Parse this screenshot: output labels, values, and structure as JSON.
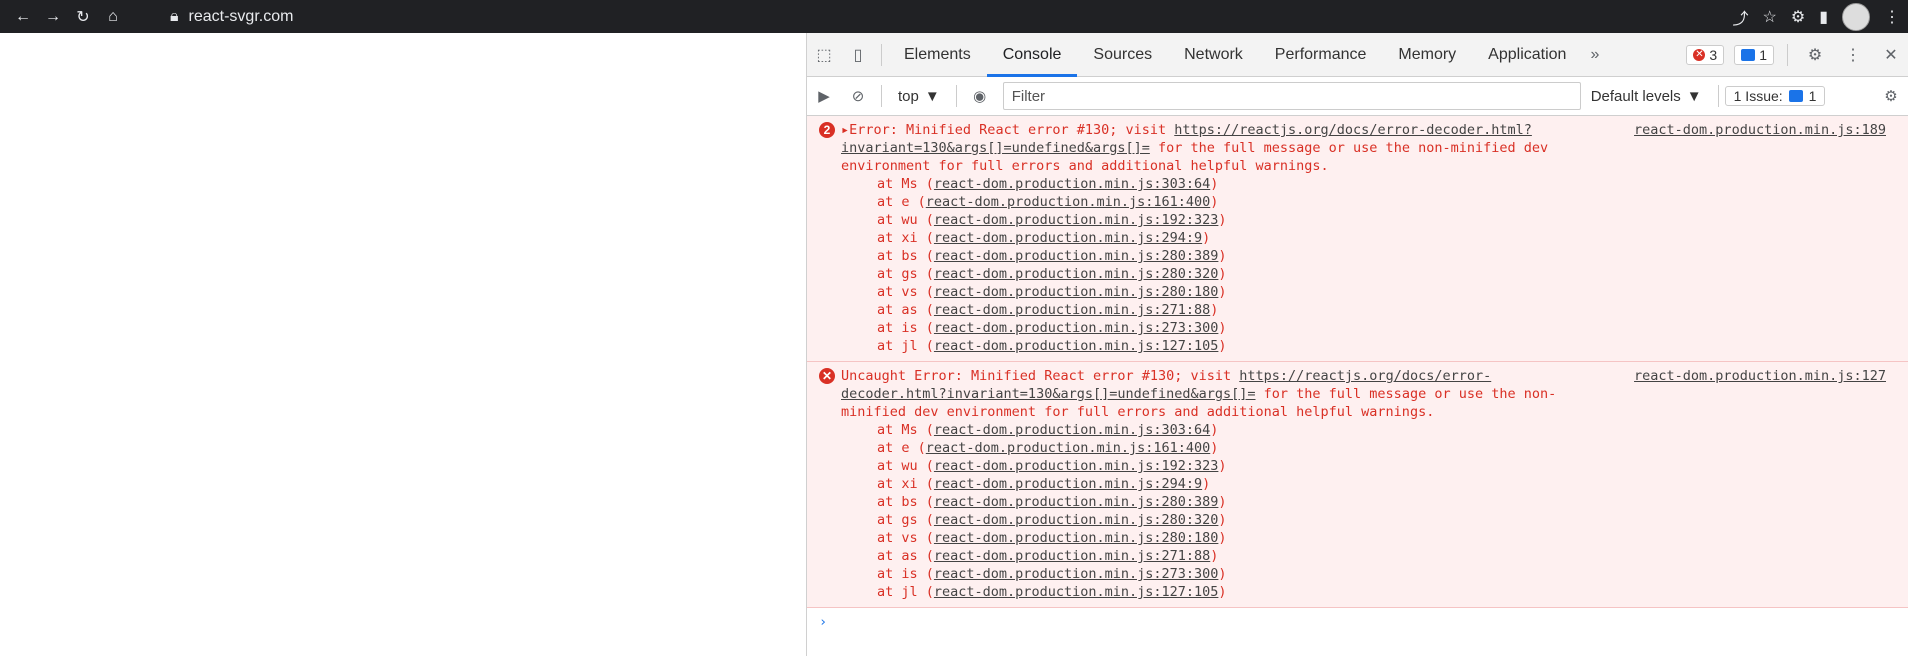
{
  "browser": {
    "url": "react-svgr.com"
  },
  "devtools": {
    "tabs": [
      {
        "label": "Elements"
      },
      {
        "label": "Console"
      },
      {
        "label": "Sources"
      },
      {
        "label": "Network"
      },
      {
        "label": "Performance"
      },
      {
        "label": "Memory"
      },
      {
        "label": "Application"
      }
    ],
    "error_count": "3",
    "message_count": "1",
    "toolbar": {
      "context": "top",
      "filter_placeholder": "Filter",
      "levels": "Default levels",
      "issues_label": "1 Issue:",
      "issues_count": "1"
    },
    "entries": [
      {
        "repeat": "2",
        "prefix": "Error: Minified React error #130; visit ",
        "link": "https://reactjs.org/docs/error-decoder.html?invariant=130&args[]=undefined&args[]=",
        "suffix": " for the full message or use the non-minified dev environment for full errors and additional helpful warnings.",
        "source": "react-dom.production.min.js:189",
        "stack": [
          {
            "fn": "at Ms (",
            "loc": "react-dom.production.min.js:303:64"
          },
          {
            "fn": "at e (",
            "loc": "react-dom.production.min.js:161:400"
          },
          {
            "fn": "at wu (",
            "loc": "react-dom.production.min.js:192:323"
          },
          {
            "fn": "at xi (",
            "loc": "react-dom.production.min.js:294:9"
          },
          {
            "fn": "at bs (",
            "loc": "react-dom.production.min.js:280:389"
          },
          {
            "fn": "at gs (",
            "loc": "react-dom.production.min.js:280:320"
          },
          {
            "fn": "at vs (",
            "loc": "react-dom.production.min.js:280:180"
          },
          {
            "fn": "at as (",
            "loc": "react-dom.production.min.js:271:88"
          },
          {
            "fn": "at is (",
            "loc": "react-dom.production.min.js:273:300"
          },
          {
            "fn": "at jl (",
            "loc": "react-dom.production.min.js:127:105"
          }
        ]
      },
      {
        "repeat": "",
        "prefix": "Uncaught Error: Minified React error #130; visit ",
        "link": "https://reactjs.org/docs/error-decoder.html?invariant=130&args[]=undefined&args[]=",
        "suffix": " for the full message or use the non-minified dev environment for full errors and additional helpful warnings.",
        "source": "react-dom.production.min.js:127",
        "stack": [
          {
            "fn": "at Ms (",
            "loc": "react-dom.production.min.js:303:64"
          },
          {
            "fn": "at e (",
            "loc": "react-dom.production.min.js:161:400"
          },
          {
            "fn": "at wu (",
            "loc": "react-dom.production.min.js:192:323"
          },
          {
            "fn": "at xi (",
            "loc": "react-dom.production.min.js:294:9"
          },
          {
            "fn": "at bs (",
            "loc": "react-dom.production.min.js:280:389"
          },
          {
            "fn": "at gs (",
            "loc": "react-dom.production.min.js:280:320"
          },
          {
            "fn": "at vs (",
            "loc": "react-dom.production.min.js:280:180"
          },
          {
            "fn": "at as (",
            "loc": "react-dom.production.min.js:271:88"
          },
          {
            "fn": "at is (",
            "loc": "react-dom.production.min.js:273:300"
          },
          {
            "fn": "at jl (",
            "loc": "react-dom.production.min.js:127:105"
          }
        ]
      }
    ]
  }
}
